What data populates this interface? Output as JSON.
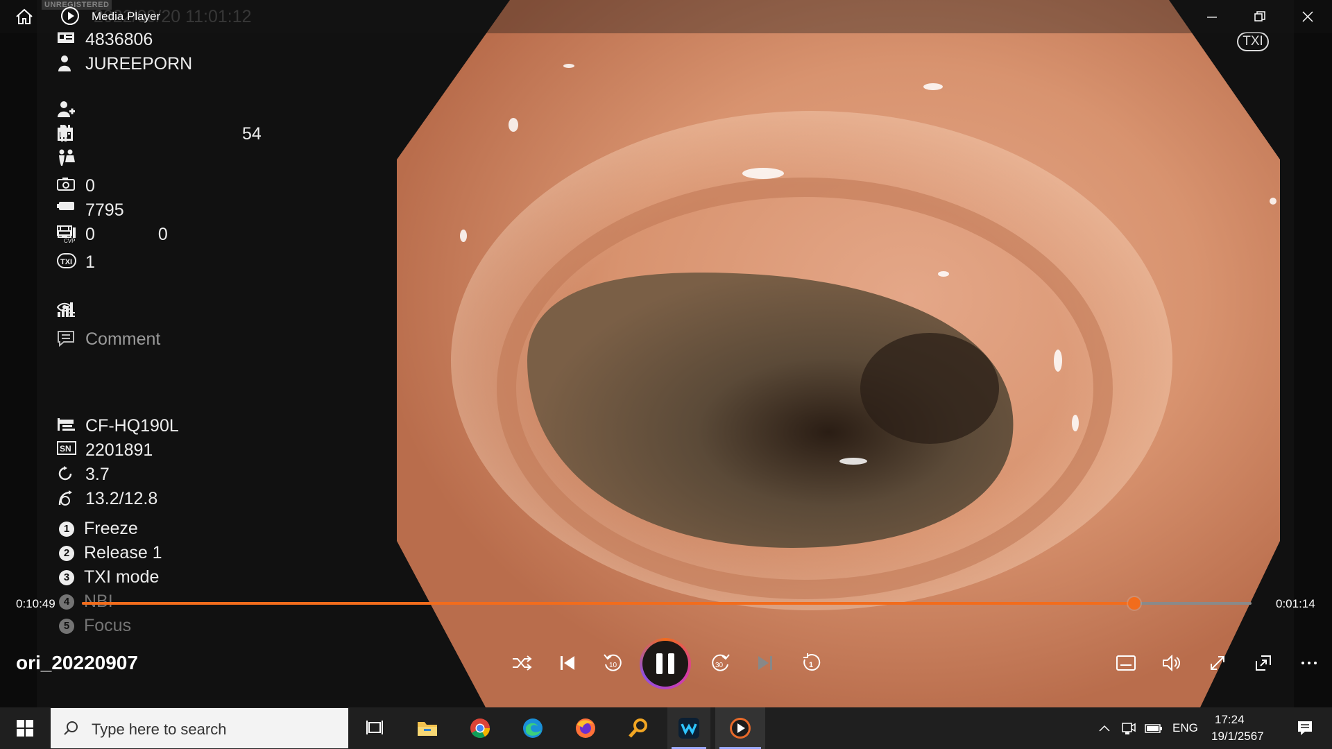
{
  "window": {
    "title": "Media Player",
    "watermark": "UNREGISTERED",
    "ghost_datetime": "2022/09/20 11:01:12"
  },
  "osd": {
    "patient_id": "4836806",
    "patient_name": "JUREEPORN",
    "age": "54",
    "image_count": "0",
    "counter": "7795",
    "monitor_count": "0",
    "cvp_count": "0",
    "txi_level": "1",
    "comment": "Comment",
    "scope_model": "CF-HQ190L",
    "serial": "2201891",
    "rotation": "3.7",
    "angle": "13.2/12.8",
    "txi_badge": "TXI",
    "sn_label": "SN",
    "buttons": [
      {
        "num": "1",
        "label": "Freeze"
      },
      {
        "num": "2",
        "label": "Release 1"
      },
      {
        "num": "3",
        "label": "TXI mode"
      },
      {
        "num": "4",
        "label": "NBI"
      },
      {
        "num": "5",
        "label": "Focus"
      }
    ]
  },
  "player": {
    "elapsed": "0:10:49",
    "remaining": "0:01:14",
    "progress": 0.9,
    "file_name": "ori_20220907",
    "accent": "#f26c1c"
  },
  "taskbar": {
    "search_placeholder": "Type here to search",
    "language": "ENG",
    "time": "17:24",
    "date": "19/1/2567"
  }
}
